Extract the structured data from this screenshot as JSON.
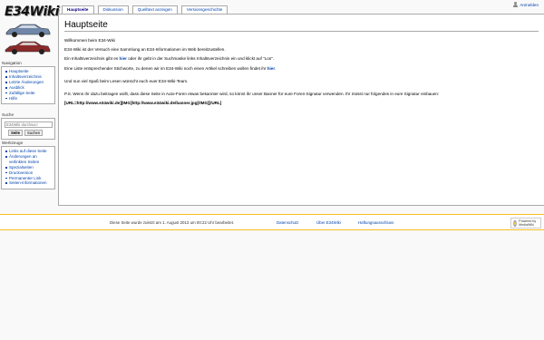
{
  "logo": {
    "text": "E34Wiki",
    "car_top_color": "#6f86a8",
    "car_bottom_color": "#8b2a2a"
  },
  "personal": {
    "login_label": "Anmelden"
  },
  "tabs": [
    {
      "label": "Hauptseite",
      "selected": true
    },
    {
      "label": "Diskussion"
    },
    {
      "label": "Quelltext anzeigen"
    },
    {
      "label": "Versionsgeschichte"
    }
  ],
  "page": {
    "title": "Hauptseite",
    "p1": "Willkommen beim E34-Wiki",
    "p2": "E34-Wiki ist der Versuch eine Sammlung an E34-Informationen im Web bereitzustellen.",
    "p3_pre": "Ein Inhaltsverzeichnis gibt es ",
    "p3_link": "hier",
    "p3_post": " oder ihr gebt in der Suchmaske links Inhaltsverzeichnis ein und klickt auf \"Los\".",
    "p4_pre": "Eine Liste entsprechender Stichworte, zu denen wir im E34-Wiki noch einen Artikel schreiben wollen findet ihr ",
    "p4_link": "hier",
    "p4_post": ".",
    "p5": "Und nun viel Spaß beim Lesen wünscht euch euer E34-Wiki-Team.",
    "p6": "P.S. Wenn ihr dazu beitragen wollt, dass diese Seite in Auto-Foren etwas bekannter wird, so könnt ihr unser Banner für eure Foren-Signatur verwenden. Ihr müsst nur folgendes in eure Signatur einbauen:",
    "p7": "[URL=http://www.e34wiki.de][IMG]http://www.e34wiki.de/banner.jpg[/IMG][/URL]"
  },
  "navigation": {
    "heading": "Navigation",
    "items": [
      "Hauptseite",
      "Inhaltsverzeichnis",
      "Letzte Änderungen",
      "Ausblick",
      "Zufällige Seite",
      "Hilfe"
    ]
  },
  "search": {
    "heading": "Suche",
    "placeholder": "E34Wiki durchsuc!",
    "go_label": "Seite",
    "search_label": "Suchen"
  },
  "toolbox": {
    "heading": "Werkzeuge",
    "items": [
      "Links auf diese Seite",
      "Änderungen an verlinkten Seiten",
      "Spezialseiten",
      "Druckversion",
      "Permanenter Link",
      "Seiten-informationen"
    ]
  },
  "footer": {
    "lastmod": "Diese Seite wurde zuletzt am 1. August 2013 um 00:22 Uhr bearbeitet.",
    "privacy": "Datenschutz",
    "about": "Über E34Wiki",
    "disclaimer": "Haftungsausschluss",
    "powered_by": "Powered by MediaWiki"
  }
}
